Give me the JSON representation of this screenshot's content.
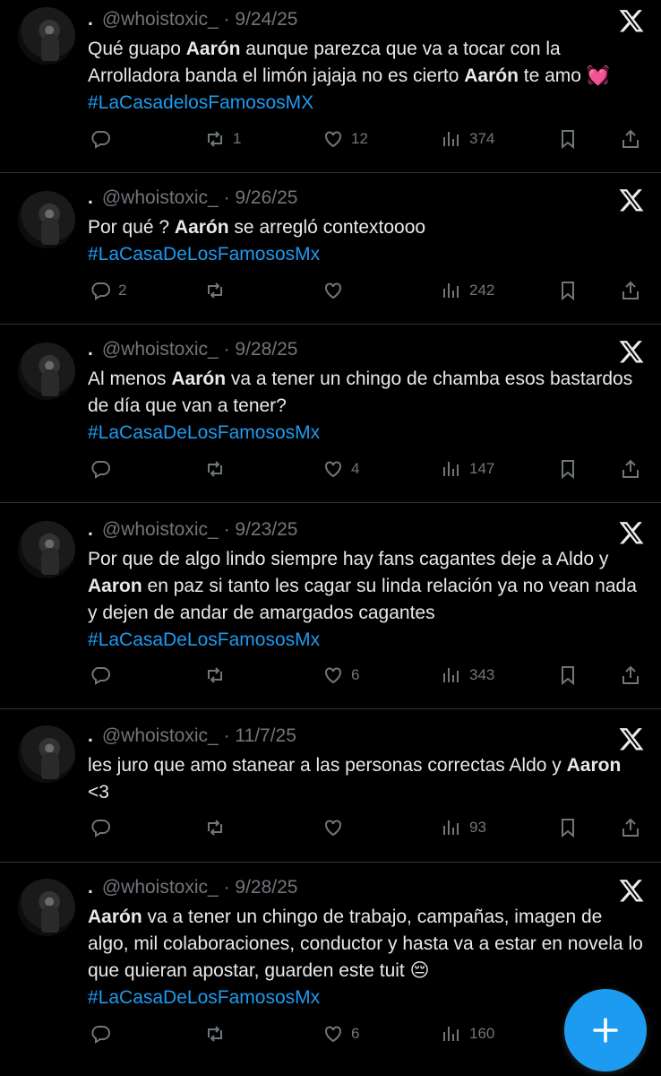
{
  "colors": {
    "background": "#000000",
    "text": "#e7e9ea",
    "muted": "#71767b",
    "accent": "#1d9bf0",
    "separator": "#2f3336"
  },
  "tweets": [
    {
      "name": ".",
      "handle": "@whoistoxic_",
      "dot": "·",
      "date": "9/24/25",
      "text_parts": [
        "Qué guapo ",
        "Aarón",
        " aunque parezca que va a tocar con la Arrolladora banda el limón jajaja no es cierto ",
        "Aarón",
        " te amo 💓 ",
        "#LaCasadelosFamososMX"
      ],
      "replies": "",
      "reposts": "1",
      "likes": "12",
      "views": "374"
    },
    {
      "name": ".",
      "handle": "@whoistoxic_",
      "dot": "·",
      "date": "9/26/25",
      "text_parts": [
        "Por qué ? ",
        "Aarón",
        " se arregló contextoooo",
        "#LaCasaDeLosFamososMx"
      ],
      "replies": "2",
      "reposts": "",
      "likes": "",
      "views": "242"
    },
    {
      "name": ".",
      "handle": "@whoistoxic_",
      "dot": "·",
      "date": "9/28/25",
      "text_parts": [
        "Al menos ",
        "Aarón",
        " va a tener un chingo de chamba esos bastardos de día que van a tener?",
        "#LaCasaDeLosFamososMx"
      ],
      "replies": "",
      "reposts": "",
      "likes": "4",
      "views": "147"
    },
    {
      "name": ".",
      "handle": "@whoistoxic_",
      "dot": "·",
      "date": "9/23/25",
      "text_parts": [
        "Por que de algo lindo siempre hay fans cagantes deje a Aldo y ",
        "Aaron",
        " en paz si tanto les cagar su linda relación ya no vean nada y dejen de andar de amargados cagantes",
        "#LaCasaDeLosFamososMx"
      ],
      "replies": "",
      "reposts": "",
      "likes": "6",
      "views": "343"
    },
    {
      "name": ".",
      "handle": "@whoistoxic_",
      "dot": "·",
      "date": "11/7/25",
      "text_parts": [
        "les juro que amo stanear a las personas correctas Aldo y ",
        "Aaron",
        " <3"
      ],
      "replies": "",
      "reposts": "",
      "likes": "",
      "views": "93"
    },
    {
      "name": ".",
      "handle": "@whoistoxic_",
      "dot": "·",
      "date": "9/28/25",
      "text_parts": [
        "Aarón",
        " va a tener un chingo de trabajo, campañas, imagen de algo, mil colaboraciones, conductor y hasta va a estar en novela lo que quieran apostar, guarden este tuit 😔",
        "#LaCasaDeLosFamososMx"
      ],
      "replies": "",
      "reposts": "",
      "likes": "6",
      "views": "160"
    }
  ],
  "icons": {
    "reply": "reply-icon",
    "repost": "repost-icon",
    "like": "heart-icon",
    "views": "views-icon",
    "bookmark": "bookmark-icon",
    "share": "share-icon",
    "remove": "x-logo-icon",
    "compose": "plus-icon"
  }
}
